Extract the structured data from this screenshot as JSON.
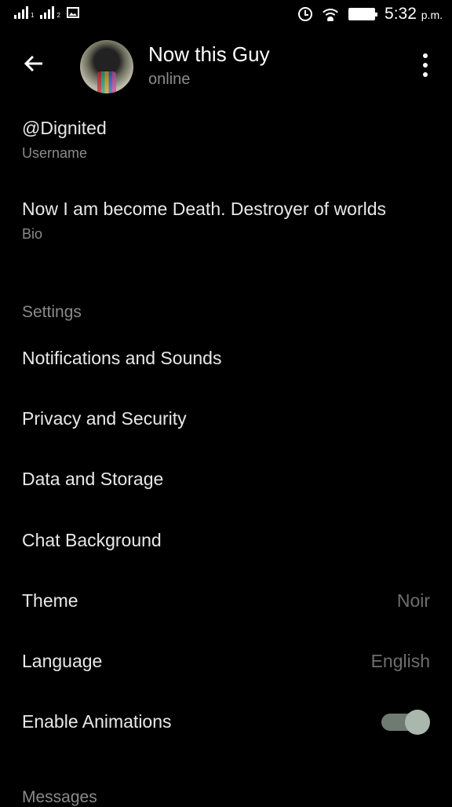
{
  "status_bar": {
    "sim1_label": "1",
    "sim2_label": "2",
    "time": "5:32",
    "ampm": "p.m."
  },
  "header": {
    "title": "Now this Guy",
    "subtitle": "online"
  },
  "profile": {
    "username_value": "@Dignited",
    "username_label": "Username",
    "bio_value": "Now I am become Death. Destroyer of worlds",
    "bio_label": "Bio"
  },
  "settings": {
    "section_title": "Settings",
    "items": [
      {
        "label": "Notifications and Sounds",
        "value": ""
      },
      {
        "label": "Privacy and Security",
        "value": ""
      },
      {
        "label": "Data and Storage",
        "value": ""
      },
      {
        "label": "Chat Background",
        "value": ""
      },
      {
        "label": "Theme",
        "value": "Noir"
      },
      {
        "label": "Language",
        "value": "English"
      },
      {
        "label": "Enable Animations",
        "toggle_on": true
      }
    ]
  },
  "messages": {
    "section_title": "Messages"
  }
}
